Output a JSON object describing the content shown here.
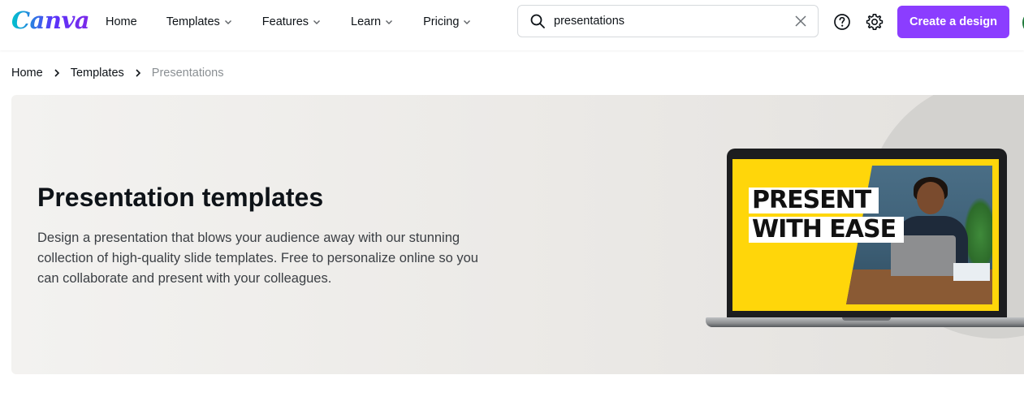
{
  "header": {
    "logo_text": "Canva",
    "nav": [
      {
        "label": "Home",
        "has_dropdown": false
      },
      {
        "label": "Templates",
        "has_dropdown": true
      },
      {
        "label": "Features",
        "has_dropdown": true
      },
      {
        "label": "Learn",
        "has_dropdown": true
      },
      {
        "label": "Pricing",
        "has_dropdown": true
      }
    ],
    "search": {
      "value": "presentations",
      "icon": "search-icon",
      "clear_icon": "close-icon"
    },
    "help_icon": "help-circle-icon",
    "settings_icon": "gear-icon",
    "create_label": "Create a design",
    "accent_color": "#8b3dff"
  },
  "breadcrumb": {
    "items": [
      "Home",
      "Templates"
    ],
    "current": "Presentations"
  },
  "hero": {
    "title": "Presentation templates",
    "description": "Design a presentation that blows your audience away with our stunning collection of high-quality slide templates. Free to personalize online so you can collaborate and present with your colleagues.",
    "illustration": {
      "line1": "PRESENT",
      "line2": "WITH EASE",
      "screen_color": "#ffd60a"
    }
  }
}
